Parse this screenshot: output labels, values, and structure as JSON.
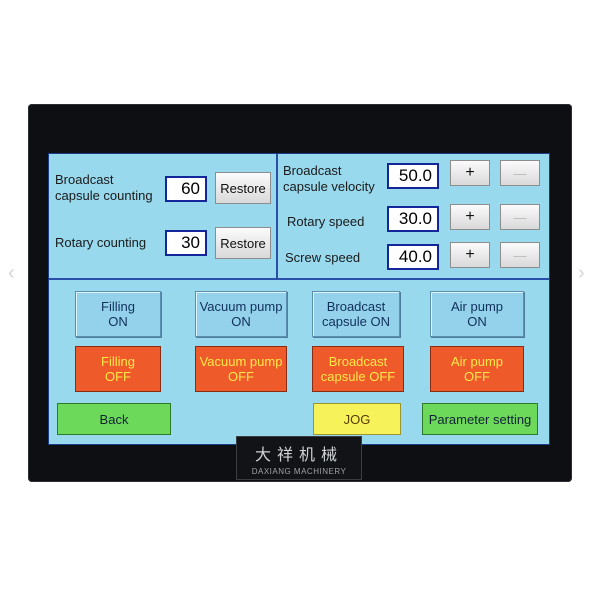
{
  "left_panel": {
    "broadcast_counting_label": [
      "Broadcast",
      "capsule counting"
    ],
    "broadcast_counting_value": "60",
    "rotary_counting_label": "Rotary counting",
    "rotary_counting_value": "30",
    "restore_label": "Restore"
  },
  "right_panel": {
    "velocity_label": [
      "Broadcast",
      "capsule velocity"
    ],
    "velocity_value": "50.0",
    "rotary_speed_label": "Rotary speed",
    "rotary_speed_value": "30.0",
    "screw_speed_label": "Screw speed",
    "screw_speed_value": "40.0",
    "plus": "+",
    "minus": "—"
  },
  "controls": {
    "filling_on": [
      "Filling",
      "ON"
    ],
    "vacuum_on": [
      "Vacuum pump",
      "ON"
    ],
    "broadcast_on": [
      "Broadcast",
      "capsule ON"
    ],
    "air_on": [
      "Air pump",
      "ON"
    ],
    "filling_off": [
      "Filling",
      "OFF"
    ],
    "vacuum_off": [
      "Vacuum pump",
      "OFF"
    ],
    "broadcast_off": [
      "Broadcast",
      "capsule OFF"
    ],
    "air_off": [
      "Air pump",
      "OFF"
    ]
  },
  "bottom": {
    "back": "Back",
    "jog": "JOG",
    "parameter_setting": "Parameter setting"
  },
  "logo": {
    "cn": "大祥机械",
    "en": "DAXIANG MACHINERY"
  },
  "nav_icons": [
    "chevron-left-icon",
    "chevron-right-icon"
  ],
  "colors": {
    "screen_bg": "#98d9ee",
    "off_button": "#ee5a2a",
    "off_text": "#ffe94a",
    "back_button": "#6dd95a",
    "jog_button": "#f6f35a",
    "frame_line": "#2a4fa8"
  }
}
